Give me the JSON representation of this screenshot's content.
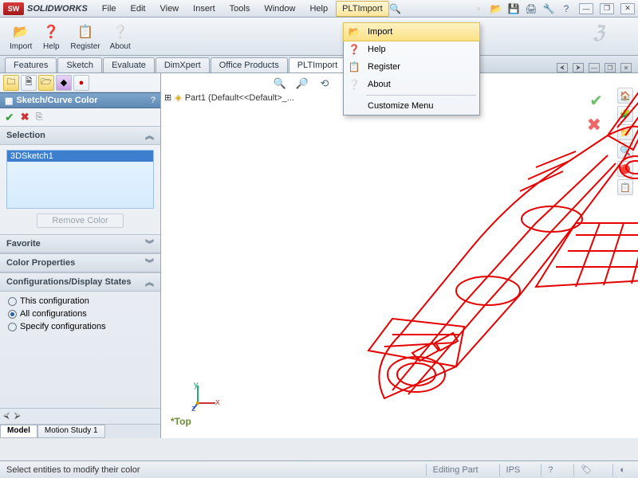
{
  "app": {
    "title": "SOLIDWORKS"
  },
  "menu": {
    "items": [
      "File",
      "Edit",
      "View",
      "Insert",
      "Tools",
      "Window",
      "Help",
      "PLTImport"
    ],
    "active": "PLTImport"
  },
  "dropdown": {
    "items": [
      "Import",
      "Help",
      "Register",
      "About"
    ],
    "hover": "Import",
    "footer": "Customize Menu"
  },
  "toolbar": {
    "buttons": [
      {
        "icon": "📂",
        "label": "Import"
      },
      {
        "icon": "❓",
        "label": "Help"
      },
      {
        "icon": "📋",
        "label": "Register"
      },
      {
        "icon": "ℹ️",
        "label": "About"
      }
    ]
  },
  "cm_tabs": [
    "Features",
    "Sketch",
    "Evaluate",
    "DimXpert",
    "Office Products",
    "PLTImport"
  ],
  "cm_active": "PLTImport",
  "panel": {
    "title": "Sketch/Curve Color",
    "help": "?",
    "selection_hdr": "Selection",
    "selection_item": "3DSketch1",
    "remove": "Remove Color",
    "favorite": "Favorite",
    "colorprops": "Color Properties",
    "config_hdr": "Configurations/Display States",
    "radios": [
      "This configuration",
      "All configurations",
      "Specify configurations"
    ],
    "radio_selected": 1
  },
  "bottom_tabs": [
    "Model",
    "Motion Study 1"
  ],
  "bottom_active": "Model",
  "tree": {
    "root": "Part1 (Default<<Default>_..."
  },
  "view": {
    "top_label": "*Top"
  },
  "status": {
    "left": "Select entities to modify their color",
    "mode": "Editing Part",
    "ips": "IPS"
  }
}
